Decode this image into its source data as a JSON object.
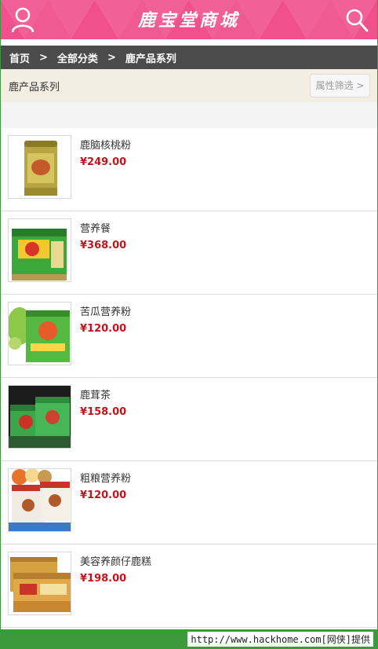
{
  "header": {
    "title": "鹿宝堂商城",
    "left_icon": "user-icon",
    "right_icon": "search-icon",
    "accent": "#f0508c"
  },
  "breadcrumb": {
    "items": [
      "首页",
      "全部分类",
      "鹿产品系列"
    ],
    "separator": ">"
  },
  "category_bar": {
    "name": "鹿产品系列",
    "filter_label": "属性筛选 >"
  },
  "products": [
    {
      "name": "鹿脑核桃粉",
      "price": "¥249.00",
      "image": "gold-can-product-image"
    },
    {
      "name": "营养餐",
      "price": "¥368.00",
      "image": "green-box-product-image"
    },
    {
      "name": "苦瓜营养粉",
      "price": "¥120.00",
      "image": "bitter-melon-box-image"
    },
    {
      "name": "鹿茸茶",
      "price": "¥158.00",
      "image": "tea-boxes-image"
    },
    {
      "name": "粗粮营养粉",
      "price": "¥120.00",
      "image": "grain-powder-boxes-image"
    },
    {
      "name": "美容养颜仔鹿糕",
      "price": "¥198.00",
      "image": "cake-box-image"
    }
  ],
  "footer": {
    "credit": "http://www.hackhome.com[网侠]提供"
  },
  "colors": {
    "price": "#c4141b",
    "breadcrumb_bg": "#4b4b4b",
    "footer_bg": "#3c9a3c"
  }
}
